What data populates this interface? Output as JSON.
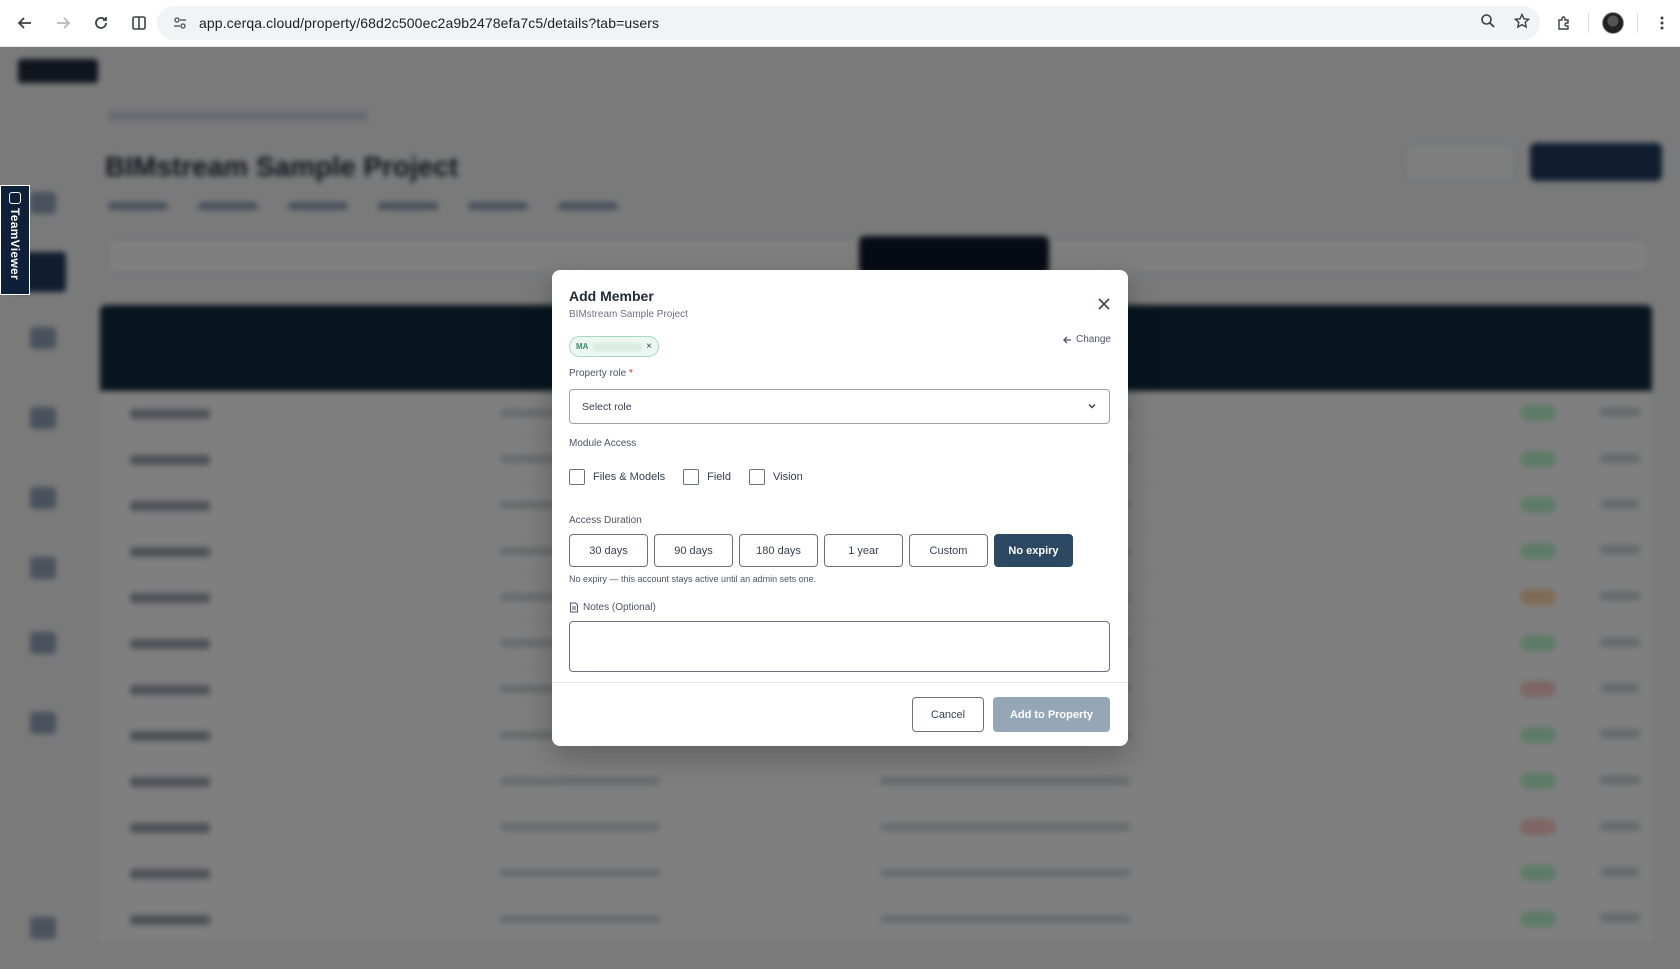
{
  "browser": {
    "url": "app.cerqa.cloud/property/68d2c500ec2a9b2478efa7c5/details?tab=users"
  },
  "background": {
    "page_title": "BIMstream Sample Project"
  },
  "teamviewer": {
    "label": "TeamViewer"
  },
  "modal": {
    "title": "Add Member",
    "subtitle": "BIMstream Sample Project",
    "member_chip": {
      "initials": "MA"
    },
    "change_label": "Change",
    "property_role": {
      "label": "Property role",
      "required_mark": "*",
      "placeholder": "Select role"
    },
    "module_access": {
      "label": "Module Access",
      "options": [
        {
          "label": "Files & Models",
          "checked": false
        },
        {
          "label": "Field",
          "checked": false
        },
        {
          "label": "Vision",
          "checked": false
        }
      ]
    },
    "access_duration": {
      "label": "Access Duration",
      "options": [
        "30 days",
        "90 days",
        "180 days",
        "1 year",
        "Custom",
        "No expiry"
      ],
      "selected": "No expiry",
      "hint": "No expiry — this account stays active until an admin sets one."
    },
    "notes": {
      "label": "Notes (Optional)",
      "value": ""
    },
    "cancel_label": "Cancel",
    "submit_label": "Add to Property"
  },
  "colors": {
    "primary": "#2c4863",
    "disabled_button": "#95a6b6",
    "chip_border": "#a7d7c5",
    "required": "#dc2626"
  }
}
